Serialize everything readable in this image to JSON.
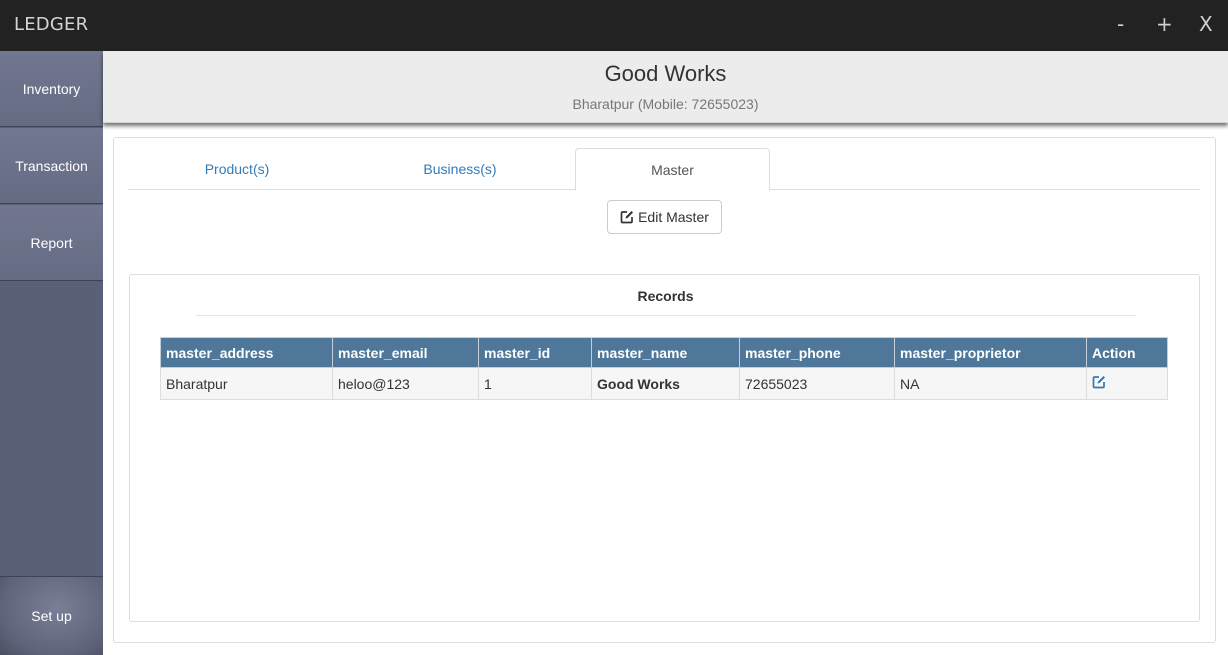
{
  "window": {
    "title": "LEDGER",
    "minimize_label": "-",
    "maximize_label": "+",
    "close_label": "X"
  },
  "sidebar": {
    "items": [
      {
        "label": "Inventory"
      },
      {
        "label": "Transaction"
      },
      {
        "label": "Report"
      },
      {
        "label": "Set up"
      }
    ]
  },
  "header": {
    "company_name": "Good Works",
    "subtitle": "Bharatpur (Mobile: 72655023)"
  },
  "tabs": [
    {
      "label": "Product(s)",
      "active": false
    },
    {
      "label": "Business(s)",
      "active": false
    },
    {
      "label": "Master",
      "active": true
    }
  ],
  "edit_master_button": {
    "label": "Edit Master",
    "icon": "edit-icon"
  },
  "records": {
    "title": "Records",
    "columns": [
      "master_address",
      "master_email",
      "master_id",
      "master_name",
      "master_phone",
      "master_proprietor",
      "Action"
    ],
    "rows": [
      {
        "master_address": "Bharatpur",
        "master_email": "heloo@123",
        "master_id": "1",
        "master_name": "Good Works",
        "master_phone": "72655023",
        "master_proprietor": "NA",
        "action_icon": "edit-icon"
      }
    ]
  },
  "colors": {
    "titlebar": "#222222",
    "sidebar": "#5b6079",
    "table_header": "#4e7799",
    "link": "#337ab7"
  }
}
